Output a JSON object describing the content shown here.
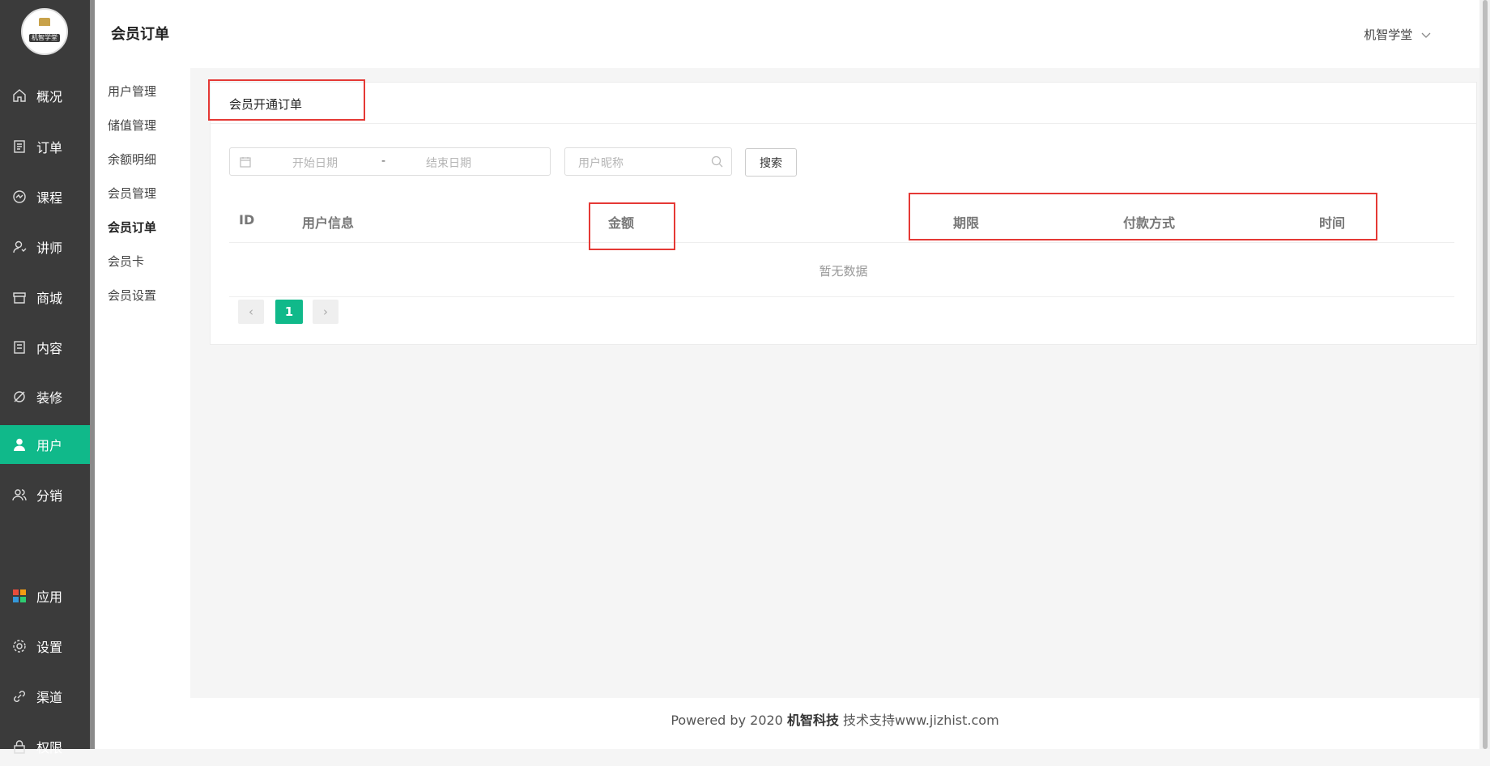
{
  "app": {
    "logo_text": "机智学堂"
  },
  "sidebar": {
    "items": [
      {
        "label": "概况",
        "icon": "home-icon"
      },
      {
        "label": "订单",
        "icon": "order-icon"
      },
      {
        "label": "课程",
        "icon": "course-icon"
      },
      {
        "label": "讲师",
        "icon": "teacher-icon"
      },
      {
        "label": "商城",
        "icon": "store-icon"
      },
      {
        "label": "内容",
        "icon": "content-icon"
      },
      {
        "label": "装修",
        "icon": "decorate-icon"
      },
      {
        "label": "用户",
        "icon": "user-icon",
        "active": true
      },
      {
        "label": "分销",
        "icon": "distribution-icon"
      },
      {
        "label": "应用",
        "icon": "apps-icon"
      },
      {
        "label": "设置",
        "icon": "gear-icon"
      },
      {
        "label": "渠道",
        "icon": "link-icon"
      },
      {
        "label": "权限",
        "icon": "lock-icon"
      }
    ],
    "active_color": "#10b98a"
  },
  "subnav": {
    "items": [
      {
        "label": "用户管理"
      },
      {
        "label": "储值管理"
      },
      {
        "label": "余额明细"
      },
      {
        "label": "会员管理"
      },
      {
        "label": "会员订单",
        "active": true
      },
      {
        "label": "会员卡"
      },
      {
        "label": "会员设置"
      }
    ]
  },
  "header": {
    "title": "会员订单",
    "user": "机智学堂"
  },
  "card": {
    "title": "会员开通订单",
    "filters": {
      "start_placeholder": "开始日期",
      "separator": "-",
      "end_placeholder": "结束日期",
      "nickname_placeholder": "用户昵称",
      "search_label": "搜索"
    },
    "table": {
      "columns": [
        "ID",
        "用户信息",
        "金额",
        "期限",
        "付款方式",
        "时间"
      ],
      "empty_text": "暂无数据"
    },
    "pagination": {
      "current": "1",
      "prev": "‹",
      "next": "›"
    }
  },
  "footer": {
    "prefix": "Powered by 2020 ",
    "brand": "机智科技",
    "suffix": " 技术支持www.jizhist.com"
  },
  "colors": {
    "accent": "#10b98a",
    "highlight": "#e53935",
    "sidebar_bg": "#3b3b3b"
  }
}
